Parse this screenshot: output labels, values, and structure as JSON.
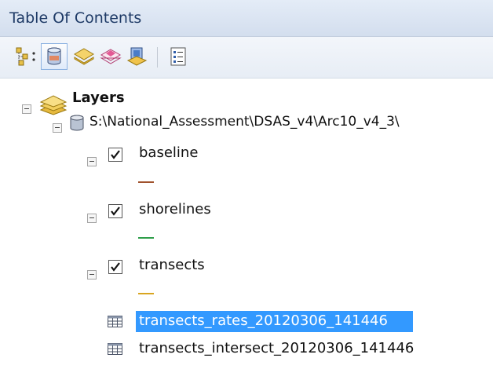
{
  "window": {
    "title": "Table Of Contents"
  },
  "toolbar": {
    "buttons": [
      {
        "name": "list-by-drawing-order",
        "icon": "drawing-order-icon"
      },
      {
        "name": "list-by-source",
        "icon": "database-icon",
        "selected": true
      },
      {
        "name": "list-by-visibility",
        "icon": "layers-visibility-icon"
      },
      {
        "name": "list-by-selection",
        "icon": "selection-icon"
      },
      {
        "name": "options",
        "icon": "options-list-icon"
      }
    ]
  },
  "tree": {
    "root": {
      "label": "Layers",
      "icon": "layers-icon",
      "expanded": true
    },
    "source": {
      "label": "S:\\National_Assessment\\DSAS_v4\\Arc10_v4_3\\",
      "icon": "database-icon",
      "expanded": true
    },
    "layers": [
      {
        "label": "baseline",
        "checked": true,
        "expanded": true,
        "symbol_color": "#a0522d"
      },
      {
        "label": "shorelines",
        "checked": true,
        "expanded": true,
        "symbol_color": "#2e9e4a"
      },
      {
        "label": "transects",
        "checked": true,
        "expanded": true,
        "symbol_color": "#d9a520"
      }
    ],
    "tables": [
      {
        "label": "transects_rates_20120306_141446",
        "icon": "table-icon",
        "selected": true
      },
      {
        "label": "transects_intersect_20120306_141446",
        "icon": "table-icon",
        "selected": false
      }
    ]
  },
  "colors": {
    "selection": "#3399ff",
    "title_text": "#1e3a66"
  }
}
